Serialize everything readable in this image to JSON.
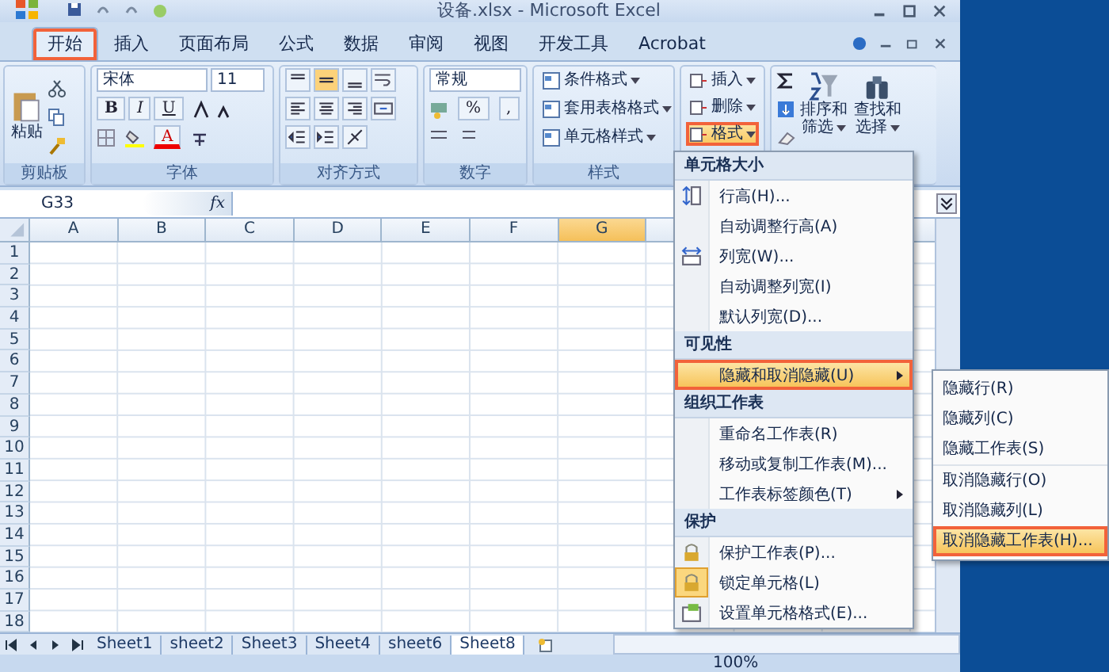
{
  "window": {
    "title": "设备.xlsx - Microsoft Excel"
  },
  "tabs": [
    {
      "label": "开始",
      "selected": true,
      "annotated": true
    },
    {
      "label": "插入",
      "selected": false,
      "annotated": false
    },
    {
      "label": "页面布局",
      "selected": false,
      "annotated": false
    },
    {
      "label": "公式",
      "selected": false,
      "annotated": false
    },
    {
      "label": "数据",
      "selected": false,
      "annotated": false
    },
    {
      "label": "审阅",
      "selected": false,
      "annotated": false
    },
    {
      "label": "视图",
      "selected": false,
      "annotated": false
    },
    {
      "label": "开发工具",
      "selected": false,
      "annotated": false
    },
    {
      "label": "Acrobat",
      "selected": false,
      "annotated": false
    }
  ],
  "ribbon": {
    "clipboard": {
      "label": "剪贴板",
      "paste": "粘贴"
    },
    "font": {
      "label": "字体",
      "font_name": "宋体",
      "font_size": "11",
      "bold": "B",
      "italic": "I",
      "underline": "U",
      "font_color": "A"
    },
    "alignment": {
      "label": "对齐方式"
    },
    "number": {
      "label": "数字",
      "format": "常规",
      "percent": "%",
      "comma": ","
    },
    "styles": {
      "label": "样式",
      "buttons": [
        "条件格式",
        "套用表格格式",
        "单元格样式"
      ]
    },
    "cells": {
      "buttons": [
        {
          "label": "插入",
          "annotated": false
        },
        {
          "label": "删除",
          "annotated": false
        },
        {
          "label": "格式",
          "annotated": true
        }
      ]
    },
    "editing": {
      "buttons": [
        {
          "line1": "排序和",
          "line2": "筛选"
        },
        {
          "line1": "查找和",
          "line2": "选择"
        }
      ]
    }
  },
  "formula_bar": {
    "name_box": "G33",
    "fx": "fx"
  },
  "sheet": {
    "columns": [
      {
        "label": "A",
        "selected": false
      },
      {
        "label": "B",
        "selected": false
      },
      {
        "label": "C",
        "selected": false
      },
      {
        "label": "D",
        "selected": false
      },
      {
        "label": "E",
        "selected": false
      },
      {
        "label": "F",
        "selected": false
      },
      {
        "label": "G",
        "selected": true
      }
    ],
    "rows": [
      "1",
      "2",
      "3",
      "4",
      "5",
      "6",
      "7",
      "8",
      "9",
      "10",
      "11",
      "12",
      "13",
      "14",
      "15",
      "16",
      "17",
      "18"
    ]
  },
  "sheet_tabs": [
    {
      "label": "Sheet1",
      "selected": false
    },
    {
      "label": "sheet2",
      "selected": false
    },
    {
      "label": "Sheet3",
      "selected": false
    },
    {
      "label": "Sheet4",
      "selected": false
    },
    {
      "label": "sheet6",
      "selected": false
    },
    {
      "label": "Sheet8",
      "selected": true
    }
  ],
  "status_bar": {
    "zoom": "100%"
  },
  "format_menu": {
    "sections": [
      {
        "header": "单元格大小",
        "items": [
          {
            "label": "行高(H)...",
            "submenu": false,
            "checked": false,
            "selected": false,
            "annotated": false
          },
          {
            "label": "自动调整行高(A)",
            "submenu": false,
            "checked": false,
            "selected": false,
            "annotated": false
          },
          {
            "label": "列宽(W)...",
            "submenu": false,
            "checked": false,
            "selected": false,
            "annotated": false
          },
          {
            "label": "自动调整列宽(I)",
            "submenu": false,
            "checked": false,
            "selected": false,
            "annotated": false
          },
          {
            "label": "默认列宽(D)...",
            "submenu": false,
            "checked": false,
            "selected": false,
            "annotated": false
          }
        ]
      },
      {
        "header": "可见性",
        "items": [
          {
            "label": "隐藏和取消隐藏(U)",
            "submenu": true,
            "checked": false,
            "selected": true,
            "annotated": true
          }
        ]
      },
      {
        "header": "组织工作表",
        "items": [
          {
            "label": "重命名工作表(R)",
            "submenu": false,
            "checked": false,
            "selected": false,
            "annotated": false
          },
          {
            "label": "移动或复制工作表(M)...",
            "submenu": false,
            "checked": false,
            "selected": false,
            "annotated": false
          },
          {
            "label": "工作表标签颜色(T)",
            "submenu": true,
            "checked": false,
            "selected": false,
            "annotated": false
          }
        ]
      },
      {
        "header": "保护",
        "items": [
          {
            "label": "保护工作表(P)...",
            "submenu": false,
            "checked": false,
            "selected": false,
            "annotated": false
          },
          {
            "label": "锁定单元格(L)",
            "submenu": false,
            "checked": true,
            "selected": false,
            "annotated": false
          },
          {
            "label": "设置单元格格式(E)...",
            "submenu": false,
            "checked": false,
            "selected": false,
            "annotated": false
          }
        ]
      }
    ]
  },
  "submenu": [
    {
      "label": "隐藏行(R)",
      "selected": false,
      "annotated": false
    },
    {
      "label": "隐藏列(C)",
      "selected": false,
      "annotated": false
    },
    {
      "label": "隐藏工作表(S)",
      "selected": false,
      "annotated": false
    },
    {
      "label": "取消隐藏行(O)",
      "selected": false,
      "annotated": false
    },
    {
      "label": "取消隐藏列(L)",
      "selected": false,
      "annotated": false
    },
    {
      "label": "取消隐藏工作表(H)...",
      "selected": true,
      "annotated": true
    }
  ]
}
